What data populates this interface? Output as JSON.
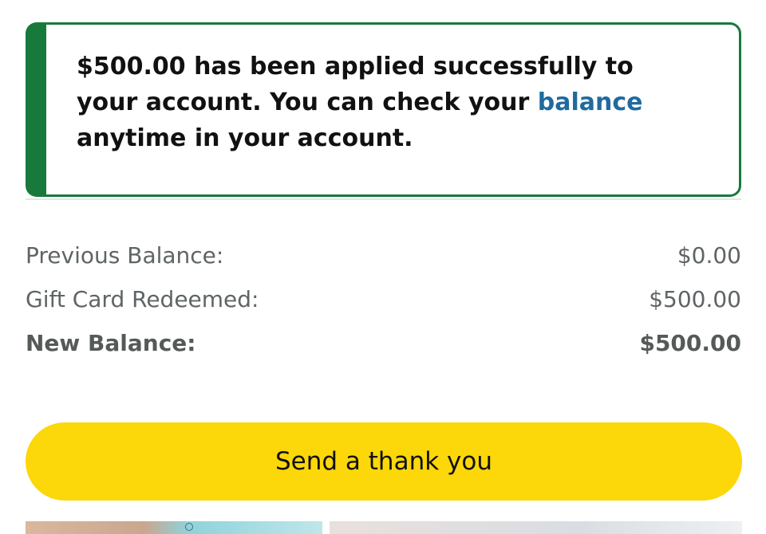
{
  "alert": {
    "message_before": "$500.00 has been applied successfully to your account. You can check your ",
    "link_text": "balance",
    "message_after": " anytime in your account."
  },
  "summary": {
    "rows": [
      {
        "label": "Previous Balance:",
        "value": "$0.00"
      },
      {
        "label": "Gift Card Redeemed:",
        "value": "$500.00"
      },
      {
        "label": "New Balance:",
        "value": "$500.00"
      }
    ]
  },
  "actions": {
    "thank_you_label": "Send a thank you"
  },
  "colors": {
    "success": "#177a3c",
    "link": "#1f6a9e",
    "button": "#fcd709"
  }
}
